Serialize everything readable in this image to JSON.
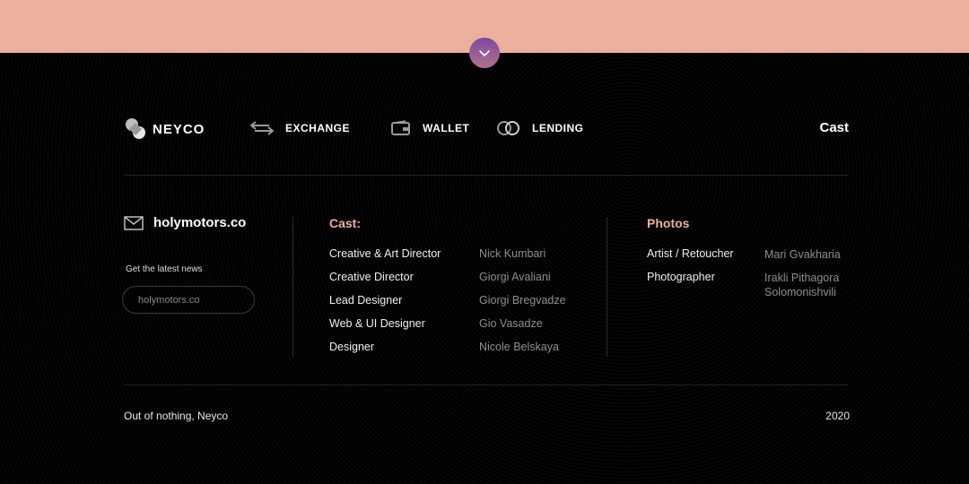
{
  "header": {
    "scroll_icon": "chevron-down-icon",
    "band_color": "#ebaf9c",
    "button_colors": [
      "#7b4aa0",
      "#b0708f"
    ]
  },
  "nav": {
    "logo": {
      "text": "NEYCO",
      "icon": "neyco-logo-icon"
    },
    "items": [
      {
        "label": "EXCHANGE",
        "icon": "exchange-arrows-icon"
      },
      {
        "label": "WALLET",
        "icon": "wallet-icon"
      },
      {
        "label": "LENDING",
        "icon": "lending-rings-icon"
      }
    ],
    "right_link": "Cast"
  },
  "contact": {
    "icon": "mail-icon",
    "domain": "holymotors.co",
    "news_label": "Get the latest news",
    "input_placeholder": "holymotors.co"
  },
  "cast": {
    "title": "Cast:",
    "title_color": "#ebaf9c",
    "rows": [
      {
        "role": "Creative & Art Director",
        "name": "Nick Kumbari"
      },
      {
        "role": "Creative Director",
        "name": "Giorgi Avaliani"
      },
      {
        "role": "Lead Designer",
        "name": "Giorgi Bregvadze"
      },
      {
        "role": "Web & UI Designer",
        "name": "Gio Vasadze"
      },
      {
        "role": "Designer",
        "name": "Nicole Belskaya"
      }
    ]
  },
  "photos": {
    "title": "Photos",
    "rows": [
      {
        "role": "Artist / Retoucher",
        "name_line1": "Mari Gvakharia",
        "name_line2": ""
      },
      {
        "role": "Photographer",
        "name_line1": "Irakli Pithagora",
        "name_line2": "Solomonishvili"
      }
    ]
  },
  "bottom": {
    "tagline": "Out of nothing, Neyco",
    "year": "2020"
  }
}
